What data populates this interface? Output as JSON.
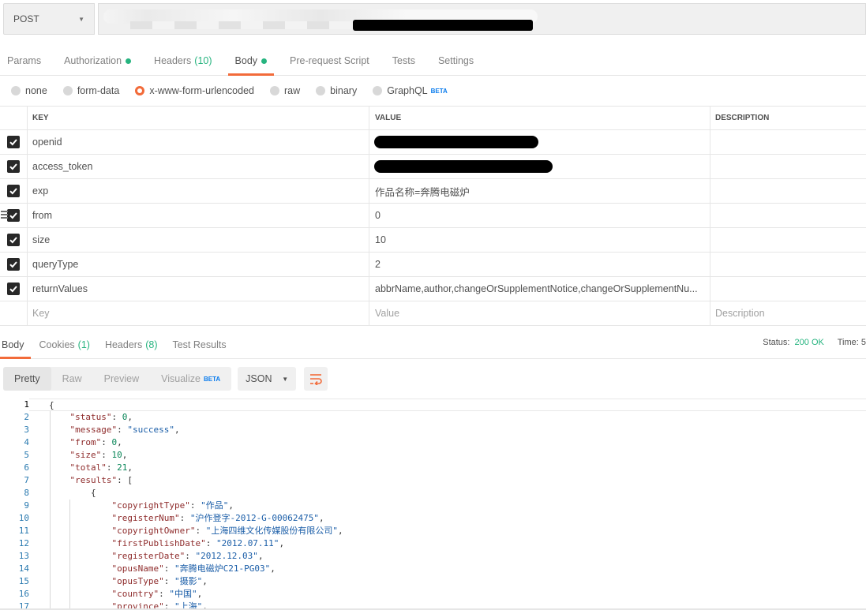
{
  "request": {
    "method": "POST",
    "url_redacted": true
  },
  "tabs": [
    {
      "label": "Params",
      "active": false,
      "dot": false,
      "count": ""
    },
    {
      "label": "Authorization",
      "active": false,
      "dot": true,
      "count": ""
    },
    {
      "label": "Headers",
      "active": false,
      "dot": false,
      "count": "(10)"
    },
    {
      "label": "Body",
      "active": true,
      "dot": true,
      "count": ""
    },
    {
      "label": "Pre-request Script",
      "active": false,
      "dot": false,
      "count": ""
    },
    {
      "label": "Tests",
      "active": false,
      "dot": false,
      "count": ""
    },
    {
      "label": "Settings",
      "active": false,
      "dot": false,
      "count": ""
    }
  ],
  "body_types": [
    {
      "label": "none",
      "selected": false,
      "badge": ""
    },
    {
      "label": "form-data",
      "selected": false,
      "badge": ""
    },
    {
      "label": "x-www-form-urlencoded",
      "selected": true,
      "badge": ""
    },
    {
      "label": "raw",
      "selected": false,
      "badge": ""
    },
    {
      "label": "binary",
      "selected": false,
      "badge": ""
    },
    {
      "label": "GraphQL",
      "selected": false,
      "badge": "BETA"
    }
  ],
  "params_table": {
    "headers": {
      "key": "KEY",
      "value": "VALUE",
      "description": "DESCRIPTION"
    },
    "rows": [
      {
        "key": "openid",
        "value": "",
        "redacted": true,
        "description": ""
      },
      {
        "key": "access_token",
        "value": "",
        "redacted": true,
        "description": ""
      },
      {
        "key": "exp",
        "value": "作品名称=奔腾电磁炉",
        "redacted": false,
        "description": ""
      },
      {
        "key": "from",
        "value": "0",
        "redacted": false,
        "description": ""
      },
      {
        "key": "size",
        "value": "10",
        "redacted": false,
        "description": ""
      },
      {
        "key": "queryType",
        "value": "2",
        "redacted": false,
        "description": ""
      },
      {
        "key": "returnValues",
        "value": "abbrName,author,changeOrSupplementNotice,changeOrSupplementNu...",
        "redacted": false,
        "description": ""
      }
    ],
    "placeholder": {
      "key": "Key",
      "value": "Value",
      "description": "Description"
    }
  },
  "response_tabs": [
    {
      "label": "Body",
      "active": true,
      "count": ""
    },
    {
      "label": "Cookies",
      "active": false,
      "count": "(1)"
    },
    {
      "label": "Headers",
      "active": false,
      "count": "(8)"
    },
    {
      "label": "Test Results",
      "active": false,
      "count": ""
    }
  ],
  "status": {
    "label": "Status:",
    "value": "200 OK",
    "time_label": "Time:",
    "time_value": "5"
  },
  "viewer": {
    "modes": [
      {
        "label": "Pretty",
        "active": true,
        "badge": ""
      },
      {
        "label": "Raw",
        "active": false,
        "badge": ""
      },
      {
        "label": "Preview",
        "active": false,
        "badge": ""
      },
      {
        "label": "Visualize",
        "active": false,
        "badge": "BETA"
      }
    ],
    "format": "JSON",
    "wrap_icon": "wrap-lines-icon"
  },
  "code_lines": [
    "{",
    "    \"status\": 0,",
    "    \"message\": \"success\",",
    "    \"from\": 0,",
    "    \"size\": 10,",
    "    \"total\": 21,",
    "    \"results\": [",
    "        {",
    "            \"copyrightType\": \"作品\",",
    "            \"registerNum\": \"沪作登字-2012-G-00062475\",",
    "            \"copyrightOwner\": \"上海四维文化传媒股份有限公司\",",
    "            \"firstPublishDate\": \"2012.07.11\",",
    "            \"registerDate\": \"2012.12.03\",",
    "            \"opusName\": \"奔腾电磁炉C21-PG03\",",
    "            \"opusType\": \"摄影\",",
    "            \"country\": \"中国\",",
    "            \"province\": \"上海\","
  ],
  "colors": {
    "accent": "#f26b3a",
    "success": "#26b47f",
    "link": "#097bed"
  }
}
